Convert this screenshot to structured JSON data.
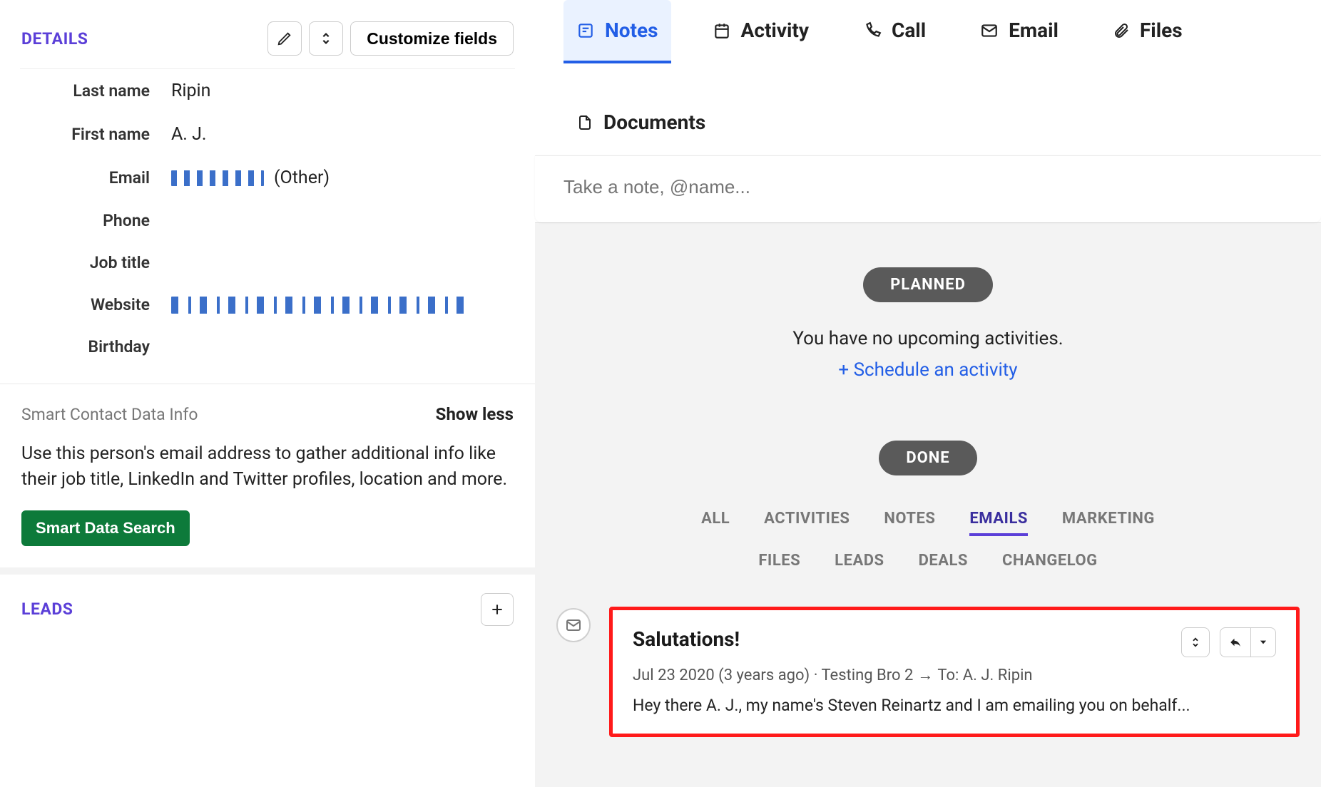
{
  "details": {
    "title": "DETAILS",
    "customize_label": "Customize fields",
    "fields": {
      "last_name_label": "Last name",
      "last_name": "Ripin",
      "first_name_label": "First name",
      "first_name": "A. J.",
      "email_label": "Email",
      "email_type": "(Other)",
      "phone_label": "Phone",
      "job_title_label": "Job title",
      "website_label": "Website",
      "birthday_label": "Birthday"
    }
  },
  "smart": {
    "title": "Smart Contact Data Info",
    "toggle": "Show less",
    "description": "Use this person's email address to gather additional info like their job title, LinkedIn and Twitter profiles, location and more.",
    "button": "Smart Data Search"
  },
  "leads": {
    "title": "LEADS"
  },
  "tabs": {
    "notes": "Notes",
    "activity": "Activity",
    "call": "Call",
    "email": "Email",
    "files": "Files",
    "documents": "Documents"
  },
  "note_placeholder": "Take a note, @name...",
  "planned": {
    "pill": "PLANNED",
    "empty": "You have no upcoming activities.",
    "schedule": "+ Schedule an activity"
  },
  "done": {
    "pill": "DONE"
  },
  "filters": {
    "all": "ALL",
    "activities": "ACTIVITIES",
    "notes": "NOTES",
    "emails": "EMAILS",
    "marketing": "MARKETING",
    "files": "FILES",
    "leads": "LEADS",
    "deals": "DEALS",
    "changelog": "CHANGELOG"
  },
  "email_card": {
    "subject": "Salutations!",
    "date": "Jul 23 2020 (3 years ago)",
    "from": "Testing Bro 2",
    "to_label": "To:",
    "to": "A. J. Ripin",
    "preview": "Hey there A. J., my name's Steven Reinartz and I am emailing you on behalf..."
  }
}
